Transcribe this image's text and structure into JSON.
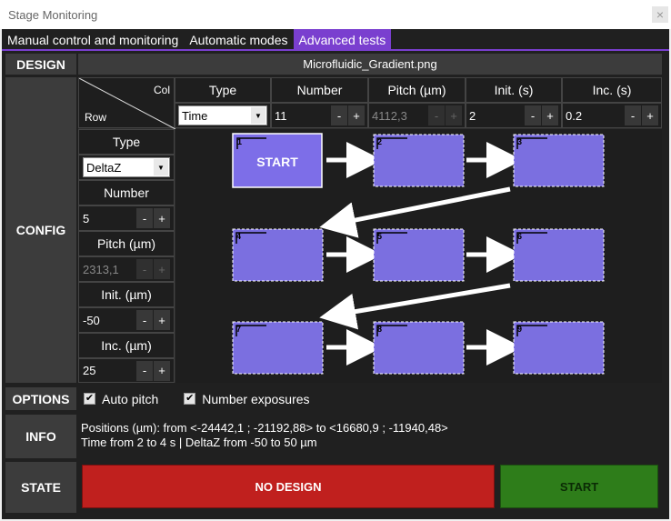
{
  "window": {
    "title": "Stage Monitoring",
    "close_icon": "×"
  },
  "tabs": [
    {
      "label": "Manual control and monitoring",
      "active": false
    },
    {
      "label": "Automatic modes",
      "active": false
    },
    {
      "label": "Advanced tests",
      "active": true
    }
  ],
  "sections": {
    "design": "DESIGN",
    "config": "CONFIG",
    "options": "OPTIONS",
    "info": "INFO",
    "state": "STATE"
  },
  "design": {
    "filename": "Microfluidic_Gradient.png"
  },
  "config": {
    "corner": {
      "col": "Col",
      "row": "Row"
    },
    "col_headers": [
      "Type",
      "Number",
      "Pitch (µm)",
      "Init. (s)",
      "Inc. (s)"
    ],
    "col_values": {
      "type": "Time",
      "number": "11",
      "pitch": "4112,3",
      "init": "2",
      "inc": "0.2"
    },
    "row_params": {
      "type_label": "Type",
      "type_value": "DeltaZ",
      "number_label": "Number",
      "number_value": "5",
      "pitch_label": "Pitch (µm)",
      "pitch_value": "2313,1",
      "init_label": "Init. (µm)",
      "init_value": "-50",
      "inc_label": "Inc. (µm)",
      "inc_value": "25"
    },
    "spin_minus": "-",
    "spin_plus": "+",
    "preview": {
      "start_label": "START",
      "tiles": [
        "1",
        "2",
        "3",
        "4",
        "5",
        "6",
        "7",
        "8",
        "9"
      ],
      "fill_color": "#7b6fe0",
      "start_color": "#7d6ee8"
    }
  },
  "options": {
    "auto_pitch": {
      "label": "Auto pitch",
      "checked": true
    },
    "number_exposures": {
      "label": "Number exposures",
      "checked": true
    },
    "check_mark": "✔"
  },
  "info": {
    "line1": "Positions (µm): from <-24442,1 ; -21192,88> to <16680,9 ; -11940,48>",
    "line2": "Time from 2 to 4 s | DeltaZ from -50 to 50 µm"
  },
  "state": {
    "status_button": "NO DESIGN",
    "start_button": "START"
  },
  "colors": {
    "accent": "#7a3fcf",
    "danger": "#c0201e",
    "success": "#2e7d1a"
  }
}
